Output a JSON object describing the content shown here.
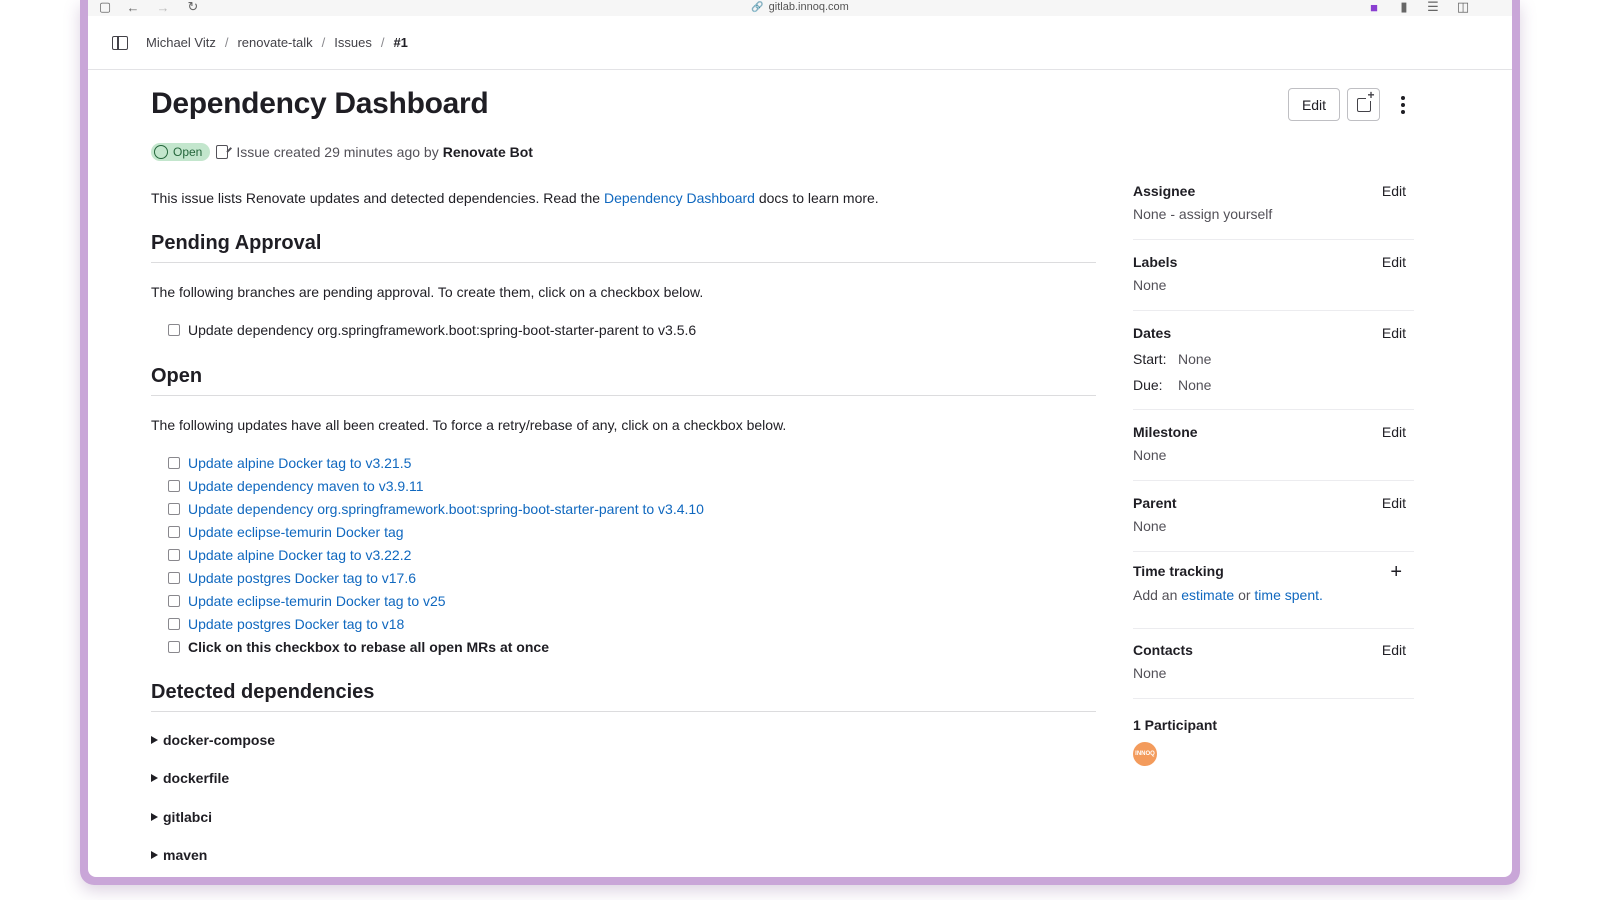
{
  "browser": {
    "url": "gitlab.innoq.com"
  },
  "breadcrumb": [
    "Michael Vitz",
    "renovate-talk",
    "Issues",
    "#1"
  ],
  "issue": {
    "title": "Dependency Dashboard",
    "status": "Open",
    "meta_text": "Issue created 29 minutes ago by",
    "author": "Renovate Bot",
    "intro_before": "This issue lists Renovate updates and detected dependencies. Read the",
    "intro_link": "Dependency Dashboard",
    "intro_after": "docs to learn more."
  },
  "actions": {
    "edit_label": "Edit"
  },
  "pending": {
    "heading": "Pending Approval",
    "description": "The following branches are pending approval. To create them, click on a checkbox below.",
    "items": [
      "Update dependency org.springframework.boot:spring-boot-starter-parent to v3.5.6"
    ]
  },
  "open": {
    "heading": "Open",
    "description": "The following updates have all been created. To force a retry/rebase of any, click on a checkbox below.",
    "items": [
      "Update alpine Docker tag to v3.21.5",
      "Update dependency maven to v3.9.11",
      "Update dependency org.springframework.boot:spring-boot-starter-parent to v3.4.10",
      "Update eclipse-temurin Docker tag",
      "Update alpine Docker tag to v3.22.2",
      "Update postgres Docker tag to v17.6",
      "Update eclipse-temurin Docker tag to v25",
      "Update postgres Docker tag to v18"
    ],
    "rebase_all": "Click on this checkbox to rebase all open MRs at once"
  },
  "detected": {
    "heading": "Detected dependencies",
    "groups": [
      "docker-compose",
      "dockerfile",
      "gitlabci",
      "maven"
    ]
  },
  "sidebar": {
    "edit_label": "Edit",
    "assignee": {
      "title": "Assignee",
      "value": "None - assign yourself"
    },
    "labels": {
      "title": "Labels",
      "value": "None"
    },
    "dates": {
      "title": "Dates",
      "start_label": "Start:",
      "start_value": "None",
      "due_label": "Due:",
      "due_value": "None"
    },
    "milestone": {
      "title": "Milestone",
      "value": "None"
    },
    "parent": {
      "title": "Parent",
      "value": "None"
    },
    "time_tracking": {
      "title": "Time tracking",
      "text_before": "Add an",
      "estimate_link": "estimate",
      "text_middle": "or",
      "spent_link": "time spent",
      "text_after": "."
    },
    "contacts": {
      "title": "Contacts",
      "value": "None"
    },
    "participants": {
      "title": "1 Participant",
      "avatar_text": "INNOQ"
    }
  }
}
